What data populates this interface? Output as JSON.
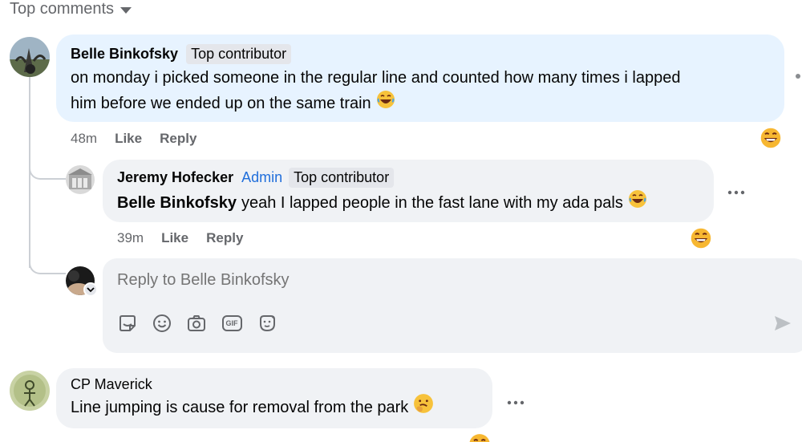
{
  "header": {
    "sort_label": "Top comments"
  },
  "comments": [
    {
      "author": "Belle Binkofsky",
      "badges": [
        "Top contributor"
      ],
      "text_line1": "on monday i picked someone in the regular line and counted how many times i lapped",
      "text_line2": "him before we ended up on the same train",
      "time": "48m",
      "like_label": "Like",
      "reply_label": "Reply",
      "reaction": "laughing-emoji"
    },
    {
      "author": "Jeremy Hofecker",
      "role": "Admin",
      "badges": [
        "Top contributor"
      ],
      "mention": "Belle Binkofsky",
      "text": "yeah I lapped people in the fast lane with my ada pals",
      "time": "39m",
      "like_label": "Like",
      "reply_label": "Reply",
      "reaction": "laughing-emoji"
    },
    {
      "author": "CP Maverick",
      "text": "Line jumping is cause for removal from the park",
      "reaction": "thinking-emoji"
    }
  ],
  "composer": {
    "placeholder": "Reply to Belle Binkofsky",
    "icons": [
      "sticker-icon",
      "emoji-icon",
      "camera-icon",
      "gif-icon",
      "avatar-sticker-icon"
    ],
    "gif_label": "GIF"
  },
  "colors": {
    "main_bubble": "#e7f3ff",
    "bubble": "#f0f2f5",
    "admin": "#216fdb",
    "muted": "#65676b"
  }
}
